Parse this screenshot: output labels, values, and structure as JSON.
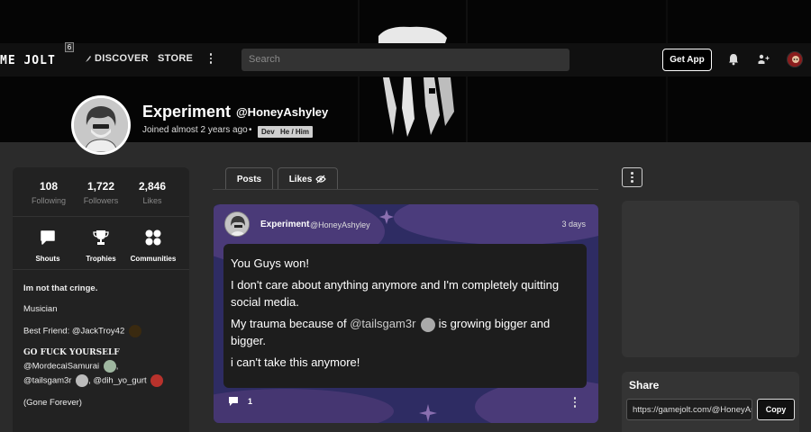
{
  "nav": {
    "logo_text": "ME JOLT",
    "logo_badge": "6",
    "discover_label": "DISCOVER",
    "store_label": "STORE",
    "search_placeholder": "Search",
    "get_app_label": "Get App"
  },
  "profile": {
    "display_name": "Experiment",
    "username": "@HoneyAshyley",
    "joined": "Joined almost 2 years ago",
    "dot": "•",
    "tags": [
      "Dev",
      "He / Him"
    ]
  },
  "sidebar": {
    "stats": [
      {
        "value": "108",
        "label": "Following"
      },
      {
        "value": "1,722",
        "label": "Followers"
      },
      {
        "value": "2,846",
        "label": "Likes"
      }
    ],
    "links": [
      {
        "label": "Shouts",
        "icon": "chat-bubble-icon"
      },
      {
        "label": "Trophies",
        "icon": "trophy-icon"
      },
      {
        "label": "Communities",
        "icon": "communities-icon"
      }
    ],
    "bio": {
      "line1": "Im not that cringe.",
      "line2": "Musician",
      "line3_prefix": "Best Friend: ",
      "line3_mention": "@JackTroy42",
      "line4": "GO FUCK YOURSELF",
      "line5_mention": "@MordecaiSamurai",
      "line5_suffix": ",",
      "line6_mention1": "@tailsgam3r",
      "line6_sep": ",",
      "line6_mention2": "@dih_yo_gurt",
      "line7": "(Gone Forever)"
    }
  },
  "tabs": {
    "posts_label": "Posts",
    "likes_label": "Likes"
  },
  "post": {
    "author": "Experiment",
    "handle": "@HoneyAshyley",
    "time": "3 days",
    "p1": "You Guys won!",
    "p2": "I don't care about anything anymore and I'm completely quitting social media.",
    "p3_prefix": "My trauma because of ",
    "p3_mention": "@tailsgam3r",
    "p3_suffix": " is growing bigger and bigger.",
    "p4": "i can't take this anymore!",
    "comment_count": "1"
  },
  "share": {
    "title": "Share",
    "url": "https://gamejolt.com/@HoneyAshyley",
    "copy_label": "Copy"
  },
  "colors": {
    "page_bg": "#2b2b2b",
    "panel_bg": "#222222",
    "nav_bg": "#101010",
    "post_bg": "#2d2d5c"
  }
}
